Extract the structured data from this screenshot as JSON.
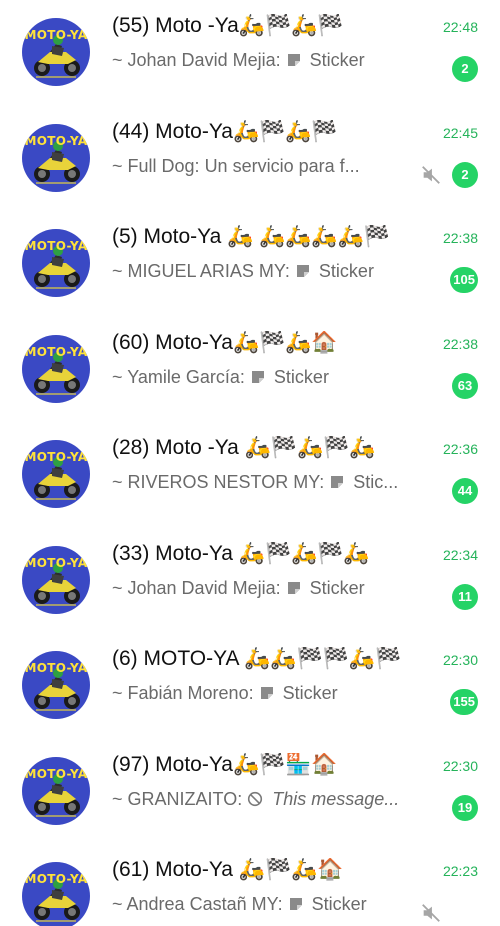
{
  "chats": [
    {
      "name": "(55) Moto -Ya🛵🏁🛵🏁",
      "sender": "~ Johan David  Mejia:",
      "message": "Sticker",
      "kind": "sticker",
      "time": "22:48",
      "unread": "2",
      "muted": false
    },
    {
      "name": "(44) Moto-Ya🛵🏁🛵🏁",
      "sender": "~ Full Dog:",
      "message": "Un servicio para f...",
      "kind": "text",
      "time": "22:45",
      "unread": "2",
      "muted": true
    },
    {
      "name": "(5) Moto-Ya 🛵 🛵🛵🛵🛵🏁",
      "sender": "~ MIGUEL ARIAS MY:",
      "message": "Sticker",
      "kind": "sticker",
      "time": "22:38",
      "unread": "105",
      "muted": false
    },
    {
      "name": "(60) Moto-Ya🛵🏁🛵🏠",
      "sender": "~ Yamile García:",
      "message": "Sticker",
      "kind": "sticker",
      "time": "22:38",
      "unread": "63",
      "muted": false
    },
    {
      "name": "(28) Moto -Ya 🛵🏁🛵🏁🛵",
      "sender": "~ RIVEROS NESTOR MY:",
      "message": "Stic...",
      "kind": "sticker",
      "time": "22:36",
      "unread": "44",
      "muted": false
    },
    {
      "name": "(33) Moto-Ya 🛵🏁🛵🏁🛵",
      "sender": "~ Johan David  Mejia:",
      "message": "Sticker",
      "kind": "sticker",
      "time": "22:34",
      "unread": "11",
      "muted": false
    },
    {
      "name": "(6) MOTO-YA 🛵🛵🏁🏁🛵🏁",
      "sender": "~ Fabián Moreno:",
      "message": "Sticker",
      "kind": "sticker",
      "time": "22:30",
      "unread": "155",
      "muted": false
    },
    {
      "name": "(97) Moto-Ya🛵🏁🏪🏠",
      "sender": "~ GRANIZAITO:",
      "message": "This message...",
      "kind": "deleted",
      "time": "22:30",
      "unread": "19",
      "muted": false
    },
    {
      "name": "(61) Moto-Ya 🛵🏁🛵🏠",
      "sender": "~ Andrea Castañ MY:",
      "message": "Sticker",
      "kind": "sticker",
      "time": "22:23",
      "unread": "",
      "muted": true
    }
  ],
  "avatar_label": "MOTO-YA",
  "colors": {
    "accent": "#25d366",
    "time": "#25b35a",
    "avatar_bg": "#3a49c4"
  },
  "icons": {
    "sticker": "sticker-icon",
    "muted": "muted-speaker-icon",
    "deleted": "prohibited-icon"
  }
}
